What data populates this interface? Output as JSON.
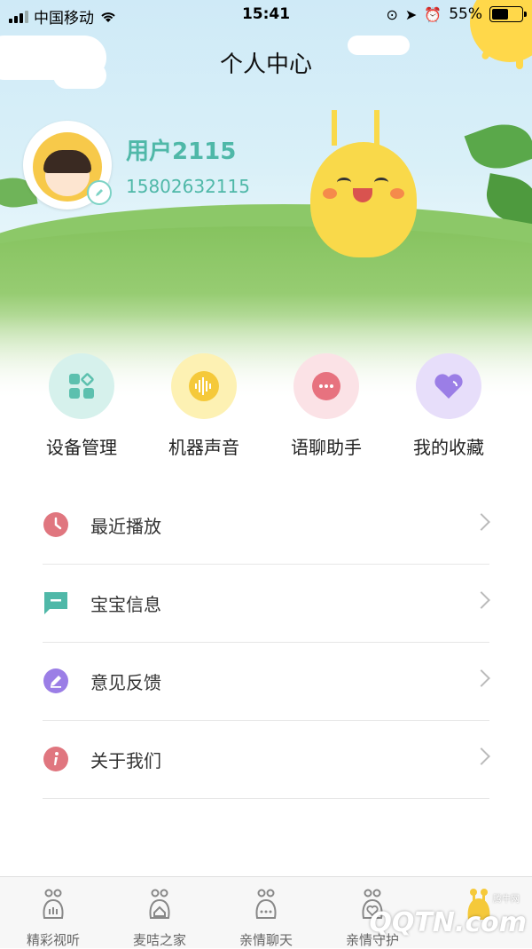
{
  "status_bar": {
    "carrier": "中国移动",
    "time": "15:41",
    "battery": "55%",
    "battery_level": 0.55
  },
  "header": {
    "title": "个人中心"
  },
  "profile": {
    "username": "用户2115",
    "phone": "15802632115"
  },
  "quick_actions": [
    {
      "label": "设备管理",
      "icon": "device-grid-icon",
      "bg": "#d6f1ec",
      "fg": "#5cc0ae"
    },
    {
      "label": "机器声音",
      "icon": "sound-wave-icon",
      "bg": "#fdf1b3",
      "fg": "#f5c93a"
    },
    {
      "label": "语聊助手",
      "icon": "chat-bubble-icon",
      "bg": "#fbe2e6",
      "fg": "#e7727f"
    },
    {
      "label": "我的收藏",
      "icon": "heart-icon",
      "bg": "#e7defa",
      "fg": "#9b7ee6"
    }
  ],
  "menu": [
    {
      "label": "最近播放",
      "icon": "clock-icon",
      "color": "#e0767f"
    },
    {
      "label": "宝宝信息",
      "icon": "message-icon",
      "color": "#4fb8a8"
    },
    {
      "label": "意见反馈",
      "icon": "edit-icon",
      "color": "#9b7ee6"
    },
    {
      "label": "关于我们",
      "icon": "info-icon",
      "color": "#e0767f"
    }
  ],
  "tabbar": {
    "items": [
      {
        "label": "精彩视听",
        "active": false
      },
      {
        "label": "麦咭之家",
        "active": false
      },
      {
        "label": "亲情聊天",
        "active": false
      },
      {
        "label": "亲情守护",
        "active": false
      },
      {
        "label": "",
        "active": true
      }
    ],
    "active_color": "#f5c93a"
  },
  "watermark": {
    "text": "QQTN.com",
    "small": "腾牛网"
  }
}
